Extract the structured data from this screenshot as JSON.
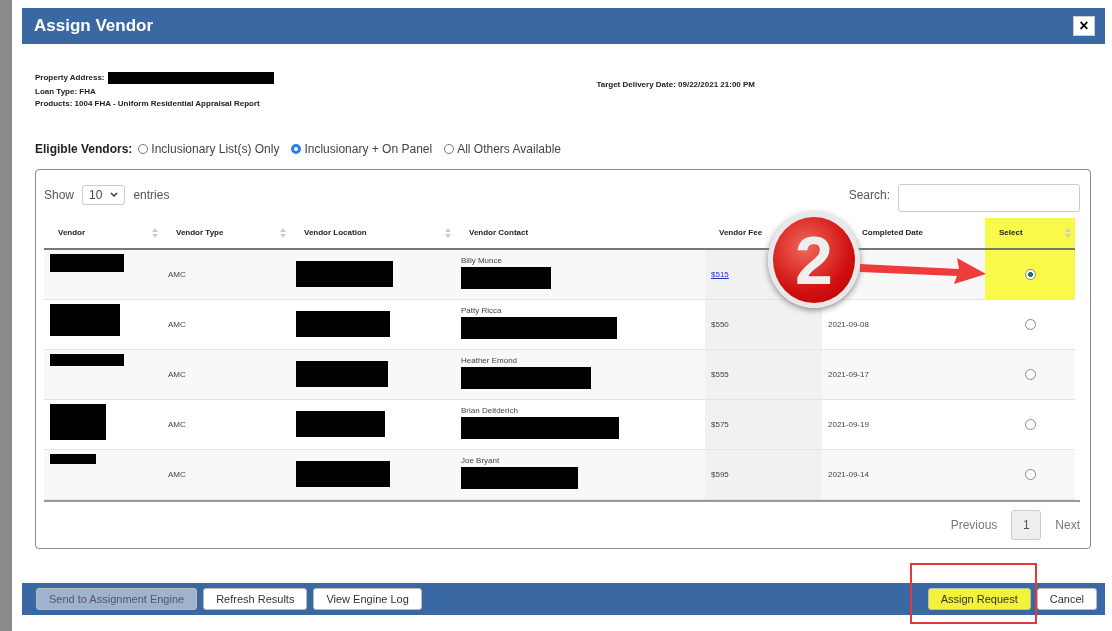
{
  "dialog": {
    "title": "Assign Vendor",
    "close": "×"
  },
  "info": {
    "property_address": {
      "label": "Property Address:",
      "redacted": true
    },
    "loan_type": "Loan Type: FHA",
    "products": "Products: 1004 FHA - Uniform Residential Appraisal Report",
    "target_delivery": "Target Delivery Date: 09/22/2021 21:00 PM"
  },
  "eligible_vendors": {
    "label": "Eligible Vendors:",
    "options": [
      {
        "label": "Inclusionary List(s) Only",
        "selected": false
      },
      {
        "label": "Inclusionary + On Panel",
        "selected": true
      },
      {
        "label": "All Others Available",
        "selected": false
      }
    ]
  },
  "table_controls": {
    "show_label": "Show",
    "page_size": "10",
    "entries_label": "entries",
    "search_label": "Search:"
  },
  "table": {
    "columns": [
      {
        "label": "Vendor",
        "sortable": true,
        "highlighted": false
      },
      {
        "label": "Vendor Type",
        "sortable": true,
        "highlighted": false
      },
      {
        "label": "Vendor Location",
        "sortable": true,
        "highlighted": false
      },
      {
        "label": "Vendor Contact",
        "sortable": false,
        "highlighted": false
      },
      {
        "label": "Vendor Fee",
        "sortable": false,
        "highlighted": false
      },
      {
        "label": "Completed Date",
        "sortable": false,
        "highlighted": false
      },
      {
        "label": "Select",
        "sortable": true,
        "highlighted": true
      }
    ],
    "rows": [
      {
        "vendor_redacted": true,
        "type": "AMC",
        "location_redacted": true,
        "contact": "Billy Munce",
        "contact_redacted": true,
        "fee": "$515",
        "fee_link": true,
        "selected": true,
        "highlighted": true
      },
      {
        "vendor_redacted": true,
        "type": "AMC",
        "location_redacted": true,
        "contact": "Patty Ricca",
        "contact_redacted": true,
        "fee": "$550",
        "fee_link": false,
        "completed": "2021-09-08",
        "selected": false,
        "highlighted": false
      },
      {
        "vendor_redacted": true,
        "type": "AMC",
        "location_redacted": true,
        "contact": "Heather Emond",
        "contact_redacted": true,
        "fee": "$555",
        "fee_link": false,
        "completed": "2021-09-17",
        "selected": false,
        "highlighted": false
      },
      {
        "vendor_redacted": true,
        "type": "AMC",
        "location_redacted": true,
        "contact": "Brian Deitderich",
        "contact_redacted": true,
        "fee": "$575",
        "fee_link": false,
        "completed": "2021-09-19",
        "selected": false,
        "highlighted": false
      },
      {
        "vendor_redacted": true,
        "type": "AMC",
        "location_redacted": true,
        "contact": "Joe Bryant",
        "contact_redacted": true,
        "fee": "$595",
        "fee_link": false,
        "completed": "2021-09-14",
        "selected": false,
        "highlighted": false
      }
    ]
  },
  "pagination": {
    "previous": "Previous",
    "pages": [
      {
        "label": "1",
        "selected": true
      }
    ],
    "next": "Next"
  },
  "footer": {
    "left_buttons": [
      {
        "label": "Send to Assignment Engine",
        "disabled": true
      },
      {
        "label": "Refresh Results",
        "disabled": false
      },
      {
        "label": "View Engine Log",
        "disabled": false
      }
    ],
    "right_buttons": [
      {
        "label": "Assign Request",
        "highlighted": true,
        "outlined": true
      },
      {
        "label": "Cancel",
        "highlighted": false,
        "outlined": false
      }
    ]
  },
  "annotation": {
    "step": "2"
  }
}
